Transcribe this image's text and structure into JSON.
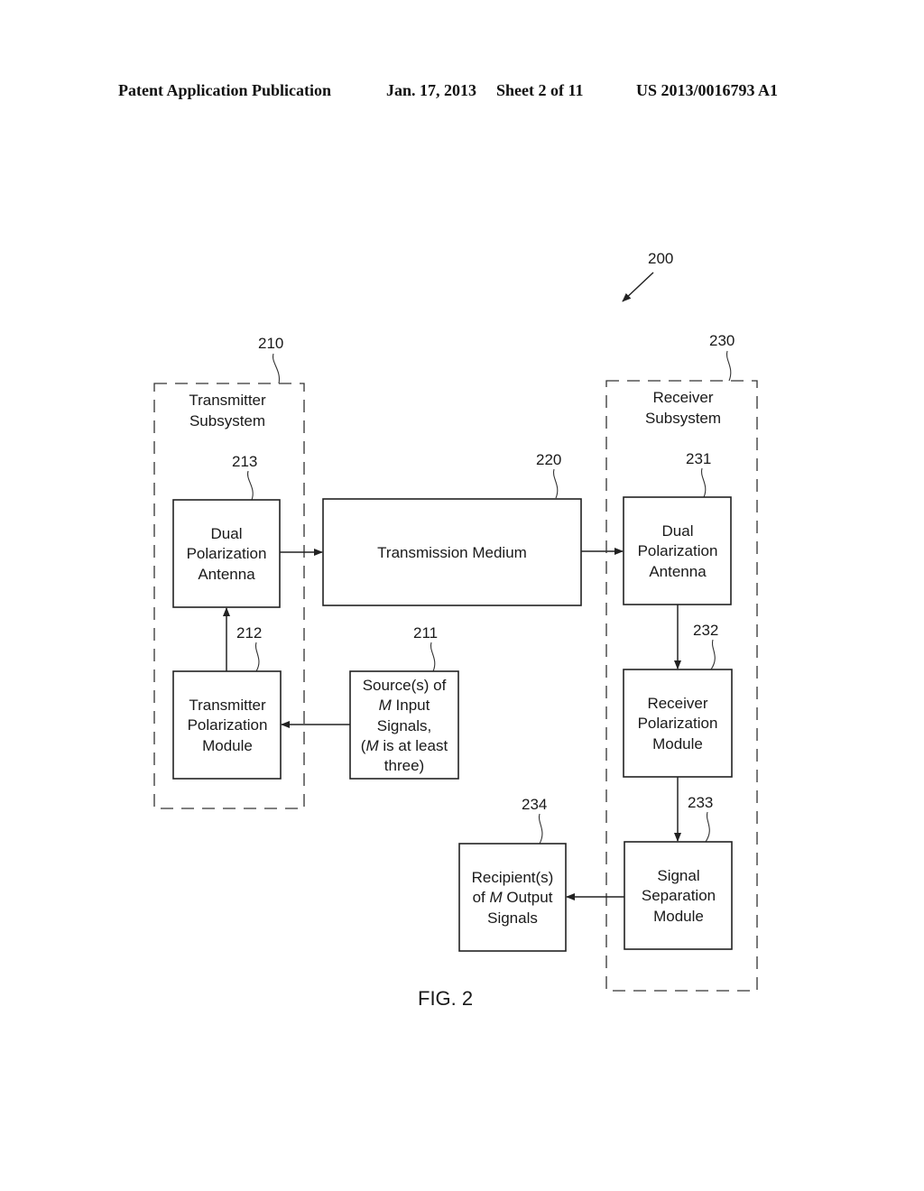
{
  "header": {
    "publication_type": "Patent Application Publication",
    "date": "Jan. 17, 2013",
    "sheet": "Sheet 2 of 11",
    "patent_number": "US 2013/0016793 A1"
  },
  "figure": {
    "label": "FIG. 2",
    "ref": "200",
    "subsystems": {
      "transmitter": {
        "ref": "210",
        "title_line1": "Transmitter",
        "title_line2": "Subsystem"
      },
      "receiver": {
        "ref": "230",
        "title_line1": "Receiver",
        "title_line2": "Subsystem"
      }
    },
    "blocks": {
      "tx_antenna": {
        "ref": "213",
        "lines": [
          "Dual",
          "Polarization",
          "Antenna"
        ]
      },
      "tx_polarization": {
        "ref": "212",
        "lines": [
          "Transmitter",
          "Polarization",
          "Module"
        ]
      },
      "source": {
        "ref": "211",
        "lines": [
          "Source(s) of",
          "Input",
          "Signals,",
          "is at least",
          "three)"
        ],
        "var": "M",
        "paren_open": "("
      },
      "medium": {
        "ref": "220",
        "label": "Transmission Medium"
      },
      "rx_antenna": {
        "ref": "231",
        "lines": [
          "Dual",
          "Polarization",
          "Antenna"
        ]
      },
      "rx_polarization": {
        "ref": "232",
        "lines": [
          "Receiver",
          "Polarization",
          "Module"
        ]
      },
      "separation": {
        "ref": "233",
        "lines": [
          "Signal",
          "Separation",
          "Module"
        ]
      },
      "recipient": {
        "ref": "234",
        "lines": [
          "Recipient(s)",
          "of",
          "Output",
          "Signals"
        ],
        "var": "M"
      }
    }
  }
}
